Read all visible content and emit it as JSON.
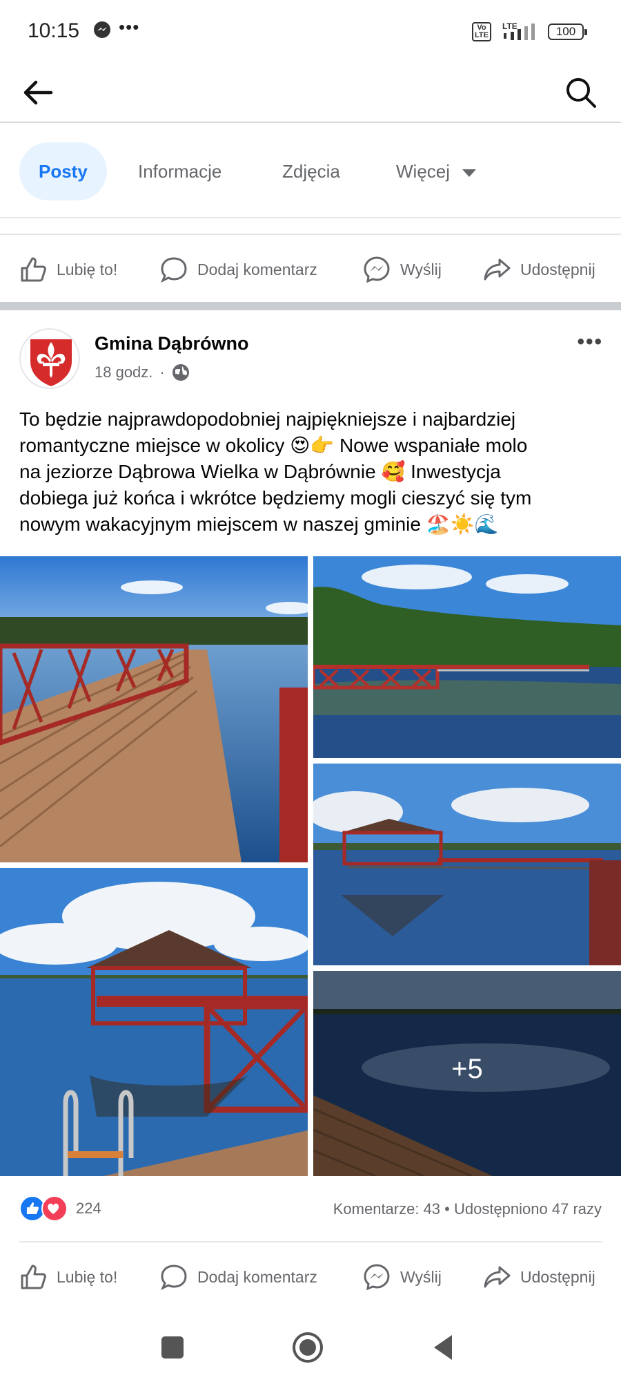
{
  "status_bar": {
    "time": "10:15",
    "messenger_icon": "messenger-icon",
    "dots": "•••",
    "volte": "Vo LTE",
    "network": "LTE",
    "battery": "100"
  },
  "header": {
    "back_icon": "arrow-left-icon",
    "search_icon": "search-icon"
  },
  "tabs": [
    {
      "label": "Posty",
      "active": true
    },
    {
      "label": "Informacje",
      "active": false
    },
    {
      "label": "Zdjęcia",
      "active": false
    },
    {
      "label": "Więcej",
      "active": false
    }
  ],
  "actions": {
    "like": "Lubię to!",
    "comment": "Dodaj komentarz",
    "send": "Wyślij",
    "share": "Udostępnij"
  },
  "post": {
    "page_name": "Gmina Dąbrówno",
    "time": "18 godz.",
    "separator": "·",
    "audience_icon": "globe-icon",
    "text_lines": [
      "To będzie najprawdopodobniej najpiękniejsze i najbardziej",
      "romantyczne miejsce w okolicy 😍👉 Nowe wspaniałe molo",
      "na jeziorze Dąbrowa Wielka w Dąbrównie 🥰 Inwestycja",
      "dobiega już końca i wkrótce będziemy mogli cieszyć się tym",
      "nowym wakacyjnym miejscem w naszej gminie 🏖️☀️🌊"
    ],
    "more_photos": "+5",
    "reaction_count": "224",
    "stats": "Komentarze: 43  •  Udostępniono 47 razy"
  },
  "colors": {
    "accent": "#1877f2",
    "pier_red": "#b5322e",
    "wood": "#b0805a",
    "sky": "#3f86d6"
  }
}
